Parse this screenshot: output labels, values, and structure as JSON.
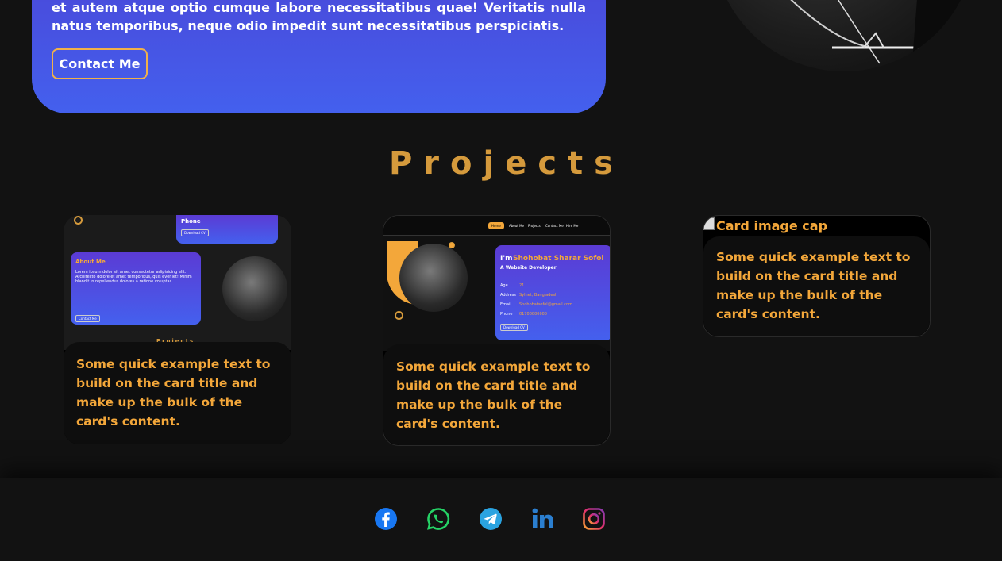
{
  "about": {
    "text": "et autem atque optio cumque labore necessitatibus quae! Veritatis nulla natus temporibus, neque odio impedit sunt necessitatibus perspiciatis.",
    "contact_label": "Contact Me"
  },
  "projects": {
    "title": "Projects",
    "cards": [
      {
        "text": "Some quick example text to build on the card title and make up the bulk of the card's content.",
        "preview": {
          "phone_label": "Phone",
          "download_label": "Download CV",
          "about_title": "About Me",
          "about_text": "Lorem ipsum dolor sit amet consectetur adipisicing elit. Architecto dolore et amet temporibus, quis eveniet! Minim blandit in repellendus dolores a ratione voluptas...",
          "contact_label": "Contact Me",
          "projects_peek": "Projects"
        }
      },
      {
        "text": "Some quick example text to build on the card title and make up the bulk of the card's content.",
        "preview": {
          "nav": [
            "Home",
            "About Me",
            "Projects",
            "Contact Me",
            "Hire Me"
          ],
          "greeting": "I'm",
          "name": "Shohobat Sharar Sofol",
          "role": "A Website Developer",
          "fields": [
            {
              "label": "Age",
              "value": "21"
            },
            {
              "label": "Address",
              "value": "Sylhet, Bangladesh"
            },
            {
              "label": "Email",
              "value": "Shohobatsofol@gmail.com"
            },
            {
              "label": "Phone",
              "value": "01700000000"
            }
          ],
          "download_label": "Download CV"
        }
      },
      {
        "image_alt": "Card image cap",
        "text": "Some quick example text to build on the card title and make up the bulk of the card's content."
      }
    ]
  },
  "footer": {
    "socials": [
      {
        "name": "facebook",
        "color": "#1877f2"
      },
      {
        "name": "whatsapp",
        "color": "#25d366"
      },
      {
        "name": "telegram",
        "color": "#2aa3e0"
      },
      {
        "name": "linkedin",
        "color": "#0a66c2"
      },
      {
        "name": "instagram",
        "color": "#e1306c"
      }
    ]
  },
  "colors": {
    "accent": "#d59a3c",
    "card_text": "#f3a73a",
    "about_bg": "#4460ee",
    "page_bg": "#121212"
  }
}
